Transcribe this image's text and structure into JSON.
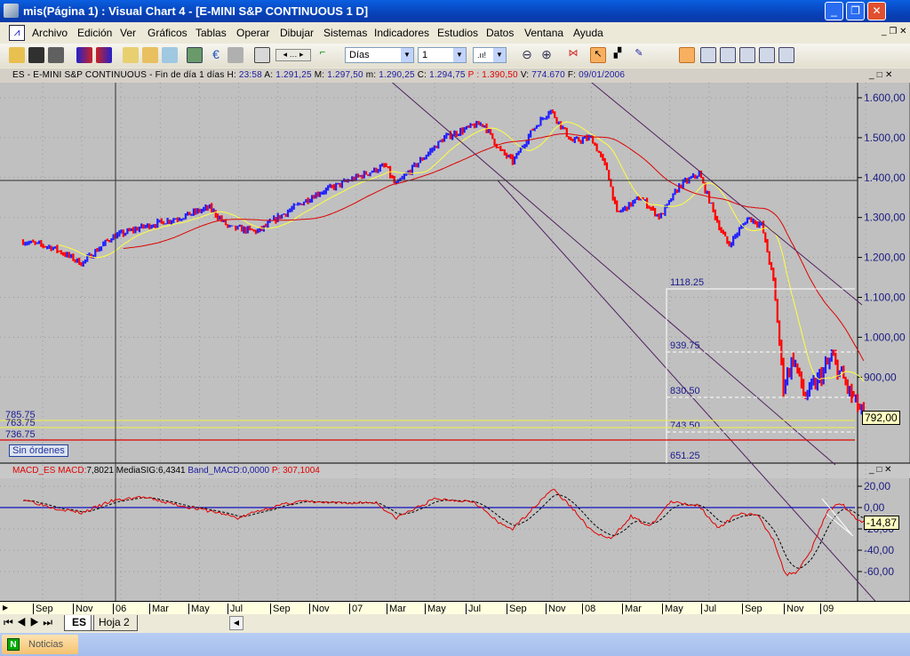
{
  "window": {
    "title": "mis(Página 1) : Visual Chart 4 - [E-MINI S&P CONTINUOUS 1 D]"
  },
  "menu": [
    "Archivo",
    "Edición",
    "Ver",
    "Gráficos",
    "Tablas",
    "Operar",
    "Dibujar",
    "Sistemas",
    "Indicadores",
    "Estudios",
    "Datos",
    "Ventana",
    "Ayuda"
  ],
  "toolbar": {
    "period": "Días",
    "interval": "1"
  },
  "info": {
    "symbol": "ES - E-MINI S&P CONTINUOUS - Fin de día 1 días",
    "h_label": "H:",
    "h": "23:58",
    "a_label": "A:",
    "a": "1.291,25",
    "m_label": "M:",
    "m": "1.297,50",
    "lo_label": "m:",
    "lo": "1.290,25",
    "c_label": "C:",
    "c": "1.294,75",
    "p": "P : 1.390,50",
    "v_label": "V:",
    "v": "774.670",
    "f_label": "F:",
    "f": "09/01/2006"
  },
  "price_axis": [
    "1.600,00",
    "1.500,00",
    "1.400,00",
    "1.300,00",
    "1.200,00",
    "1.100,00",
    "1.000,00",
    "900,00"
  ],
  "last_price": "792,00",
  "levels": {
    "l1": "785.75",
    "l2": "763.75",
    "l3": "736.75"
  },
  "fib": [
    "1118.25",
    "939.75",
    "830.50",
    "743.50",
    "651.25"
  ],
  "orders_label": "Sin órdenes",
  "macd": {
    "name": "MACD_ES",
    "macd_label": "MACD:",
    "macd": "7,8021",
    "sig_label": "MediaSIG:",
    "sig": "6,4341",
    "band_label": "Band_MACD:",
    "band": "0,0000",
    "p": "P: 307,1004",
    "axis": [
      "20,00",
      "0,00",
      "-20,00",
      "-40,00",
      "-60,00"
    ],
    "last": "-14,87"
  },
  "time_axis": [
    "Sep",
    "Nov",
    "06",
    "Mar",
    "May",
    "Jul",
    "Sep",
    "Nov",
    "07",
    "Mar",
    "May",
    "Jul",
    "Sep",
    "Nov",
    "08",
    "Mar",
    "May",
    "Jul",
    "Sep",
    "Nov",
    "09"
  ],
  "tabs": [
    "ES",
    "Hoja 2"
  ],
  "taskbar": {
    "item": "Noticias"
  },
  "colors": {
    "up": "#2020ff",
    "down": "#ff0000",
    "ma_fast": "#ffff40",
    "ma_slow": "#e00000",
    "channel": "#502060"
  },
  "chart_data": {
    "type": "line",
    "title": "ES - E-MINI S&P CONTINUOUS daily",
    "ylim": [
      650,
      1640
    ],
    "x_unit": "months since Aug 2005",
    "price_path": [
      [
        0,
        1240
      ],
      [
        1.5,
        1225
      ],
      [
        3,
        1185
      ],
      [
        4.5,
        1250
      ],
      [
        6,
        1275
      ],
      [
        8,
        1300
      ],
      [
        9.5,
        1325
      ],
      [
        10.5,
        1275
      ],
      [
        12,
        1265
      ],
      [
        13,
        1300
      ],
      [
        15,
        1360
      ],
      [
        17,
        1400
      ],
      [
        18.5,
        1430
      ],
      [
        19,
        1380
      ],
      [
        20,
        1430
      ],
      [
        21.5,
        1500
      ],
      [
        23,
        1530
      ],
      [
        23.5,
        1535
      ],
      [
        24.3,
        1470
      ],
      [
        25,
        1440
      ],
      [
        26,
        1520
      ],
      [
        26.9,
        1570
      ],
      [
        28,
        1490
      ],
      [
        29,
        1500
      ],
      [
        29.8,
        1420
      ],
      [
        30.3,
        1310
      ],
      [
        31.5,
        1350
      ],
      [
        32.5,
        1300
      ],
      [
        33.5,
        1380
      ],
      [
        34.5,
        1410
      ],
      [
        35.5,
        1280
      ],
      [
        36,
        1230
      ],
      [
        37,
        1300
      ],
      [
        37.7,
        1280
      ],
      [
        38.3,
        1140
      ],
      [
        38.8,
        880
      ],
      [
        39.3,
        950
      ],
      [
        39.9,
        850
      ],
      [
        40.4,
        880
      ],
      [
        41.3,
        950
      ],
      [
        42.2,
        860
      ],
      [
        43,
        792
      ]
    ],
    "macd_path": [
      [
        0,
        8
      ],
      [
        1.5,
        0
      ],
      [
        3,
        -5
      ],
      [
        4.5,
        6
      ],
      [
        6,
        10
      ],
      [
        8,
        2
      ],
      [
        10,
        -5
      ],
      [
        11,
        -10
      ],
      [
        12,
        -3
      ],
      [
        14,
        6
      ],
      [
        16,
        4
      ],
      [
        18,
        5
      ],
      [
        19,
        -10
      ],
      [
        21,
        8
      ],
      [
        23,
        6
      ],
      [
        24.3,
        -15
      ],
      [
        25,
        -20
      ],
      [
        27,
        18
      ],
      [
        28,
        0
      ],
      [
        29,
        -22
      ],
      [
        30,
        -30
      ],
      [
        31,
        -8
      ],
      [
        32,
        -18
      ],
      [
        33,
        5
      ],
      [
        34.5,
        2
      ],
      [
        35.5,
        -20
      ],
      [
        36.5,
        -5
      ],
      [
        37.5,
        -8
      ],
      [
        38.3,
        -30
      ],
      [
        38.9,
        -63
      ],
      [
        39.5,
        -60
      ],
      [
        40.2,
        -40
      ],
      [
        41,
        -5
      ],
      [
        41.7,
        5
      ],
      [
        42.5,
        -10
      ],
      [
        43,
        -14.87
      ]
    ],
    "macd_ylim": [
      -70,
      30
    ]
  }
}
